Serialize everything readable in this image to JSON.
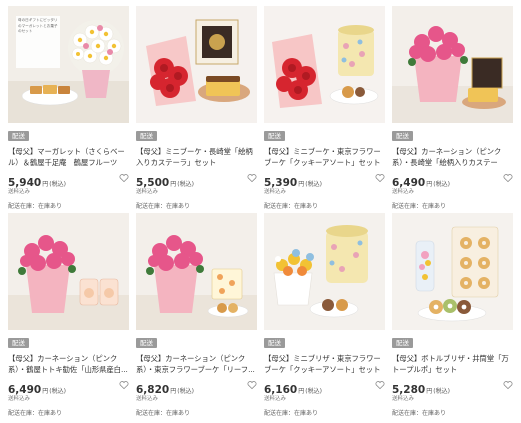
{
  "products": [
    {
      "badge": "配送",
      "title": "【母父】マーガレット（さくらベール）＆鶴屋千足庵　鶴屋フルーツク...",
      "price": "5,940",
      "yen": "円",
      "tax": "(税込)",
      "tax_note": "送料込み",
      "stock": "配送在庫：在庫あり",
      "thumb_text": "母の日ギフトにピッタリのマーガレットとお菓子のセット"
    },
    {
      "badge": "配送",
      "title": "【母父】ミニブーケ・長崎堂「絵柄入りカステーラ」セット",
      "price": "5,500",
      "yen": "円",
      "tax": "(税込)",
      "tax_note": "送料込み",
      "stock": "配送在庫：在庫あり"
    },
    {
      "badge": "配送",
      "title": "【母父】ミニブーケ・東京フラワーブーケ「クッキーアソート」セット",
      "price": "5,390",
      "yen": "円",
      "tax": "(税込)",
      "tax_note": "送料込み",
      "stock": "配送在庫：在庫あり"
    },
    {
      "badge": "配送",
      "title": "【母父】カーネーション（ピンク系）・長崎堂「絵柄入りカステーラ」...",
      "price": "6,490",
      "yen": "円",
      "tax": "(税込)",
      "tax_note": "送料込み",
      "stock": "配送在庫：在庫あり"
    },
    {
      "badge": "配送",
      "title": "【母父】カーネーション（ピンク系）・鶴屋トトキ勧佐「山形県産白...",
      "price": "6,490",
      "yen": "円",
      "tax": "(税込)",
      "tax_note": "送料込み",
      "stock": "配送在庫：在庫あり"
    },
    {
      "badge": "配送",
      "title": "【母父】カーネーション（ピンク系）・東京フラワーブーケ「リーフ...",
      "price": "6,820",
      "yen": "円",
      "tax": "(税込)",
      "tax_note": "送料込み",
      "stock": "配送在庫：在庫あり"
    },
    {
      "badge": "配送",
      "title": "【母父】ミニブリザ・東京フラワーブーケ「クッキーアソート」セット",
      "price": "6,160",
      "yen": "円",
      "tax": "(税込)",
      "tax_note": "送料込み",
      "stock": "配送在庫：在庫あり"
    },
    {
      "badge": "配送",
      "title": "【母父】ボトルブリザ・井筒堂「万トープルポ」セット",
      "price": "5,280",
      "yen": "円",
      "tax": "(税込)",
      "tax_note": "送料込み",
      "stock": "配送在庫：在庫あり"
    }
  ]
}
